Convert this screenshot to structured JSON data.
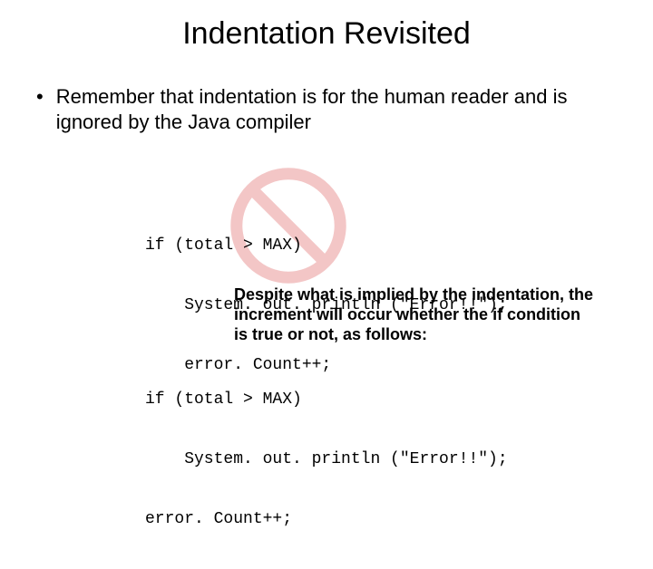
{
  "title": "Indentation Revisited",
  "bullet": "Remember that indentation is for the human reader and is ignored by the Java compiler",
  "code1_line1": "if (total > MAX)",
  "code1_line2": "    System. out. println (\"Error!!\");",
  "code1_line3": "    error. Count++;",
  "explain": "Despite what is implied by the indentation, the increment will occur whether the if condition is true or not, as follows:",
  "code2_line1": "if (total > MAX)",
  "code2_line2": "    System. out. println (\"Error!!\");",
  "code2_line3": "error. Count++;"
}
